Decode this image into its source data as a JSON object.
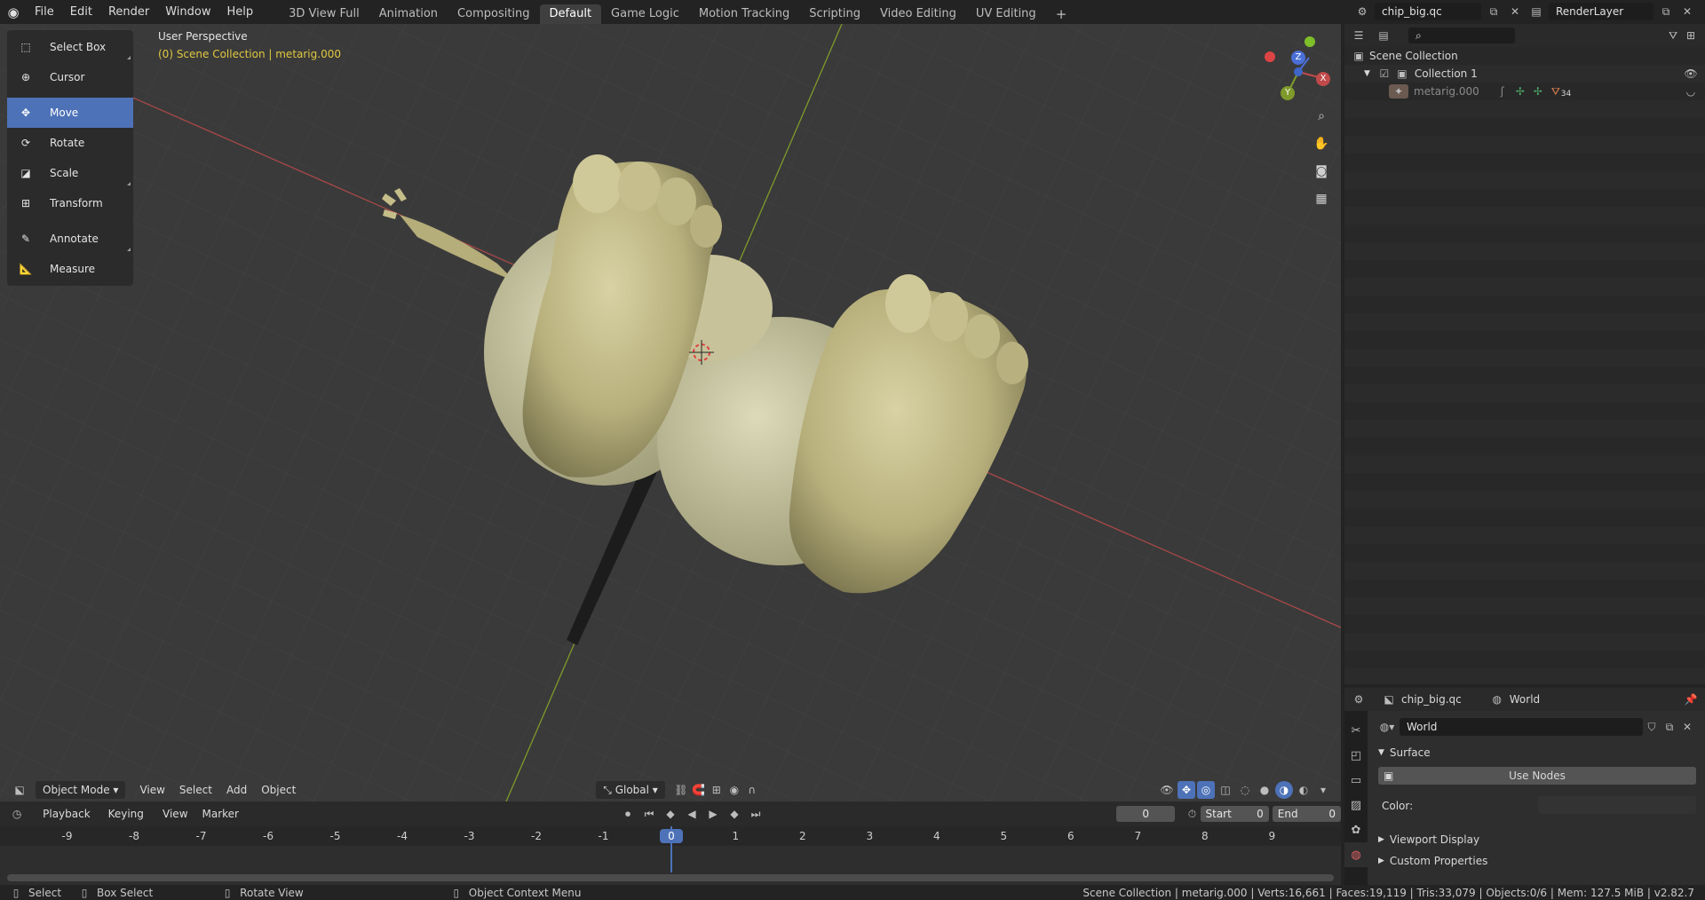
{
  "menus": [
    "File",
    "Edit",
    "Render",
    "Window",
    "Help"
  ],
  "workspaces": [
    "3D View Full",
    "Animation",
    "Compositing",
    "Default",
    "Game Logic",
    "Motion Tracking",
    "Scripting",
    "Video Editing",
    "UV Editing"
  ],
  "active_workspace": "Default",
  "scene_name": "chip_big.qc",
  "layer_name": "RenderLayer",
  "toolbar": {
    "tools": [
      "Select Box",
      "Cursor",
      "Move",
      "Rotate",
      "Scale",
      "Transform",
      "Annotate",
      "Measure"
    ],
    "active": "Move"
  },
  "viewport": {
    "perspective_label": "User Perspective",
    "collection_label": "(0) Scene Collection | metarig.000",
    "gizmo_axes": [
      "Z",
      "X",
      "Y"
    ]
  },
  "viewport_header": {
    "mode": "Object Mode",
    "menus": [
      "View",
      "Select",
      "Add",
      "Object"
    ],
    "orientation": "Global"
  },
  "timeline_header": {
    "playback": "Playback",
    "keying": "Keying",
    "view": "View",
    "marker": "Marker",
    "current_frame": "0",
    "start_label": "Start",
    "start": "0",
    "end_label": "End",
    "end": "0"
  },
  "timeline": {
    "ticks": [
      "-9",
      "-8",
      "-7",
      "-6",
      "-5",
      "-4",
      "-3",
      "-2",
      "-1",
      "0",
      "1",
      "2",
      "3",
      "4",
      "5",
      "6",
      "7",
      "8",
      "9"
    ],
    "current": "0"
  },
  "status": {
    "select": "Select",
    "box_select": "Box Select",
    "rotate_view": "Rotate View",
    "context_menu": "Object Context Menu",
    "stats": "Scene Collection | metarig.000 | Verts:16,661 | Faces:19,119 | Tris:33,079 | Objects:0/6 | Mem: 127.5 MiB | v2.82.7"
  },
  "outliner": {
    "search_placeholder": "",
    "rows": [
      {
        "label": "Scene Collection"
      },
      {
        "label": "Collection 1"
      },
      {
        "label": "metarig.000",
        "badge": "34"
      }
    ]
  },
  "properties": {
    "scene": "chip_big.qc",
    "world": "World",
    "world_field": "World",
    "surface": "Surface",
    "use_nodes": "Use Nodes",
    "color_label": "Color:",
    "viewport_display": "Viewport Display",
    "custom_properties": "Custom Properties"
  },
  "colors": {
    "active_blue": "#4d72b8",
    "axis_x": "#c04a4a",
    "axis_y": "#7f9a2a",
    "highlight_text": "#e0c840",
    "mesh": "#c8c08e"
  }
}
